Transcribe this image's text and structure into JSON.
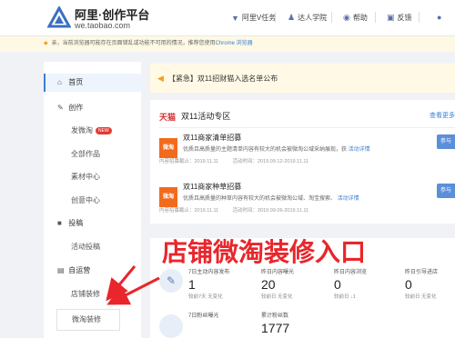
{
  "header": {
    "title": "阿里·创作平台",
    "subtitle": "we.taobao.com",
    "nav": [
      {
        "label": "阿里V任务",
        "icon": "v-task-icon"
      },
      {
        "label": "达人学院",
        "icon": "academy-icon"
      },
      {
        "label": "帮助",
        "icon": "help-icon"
      },
      {
        "label": "反馈",
        "icon": "feedback-icon"
      }
    ]
  },
  "notice": {
    "text": "亲，当前浏览器可能存在页面错乱或功能不可用的情况，推荐您使用",
    "link": "Chrome 浏览器"
  },
  "sidebar": {
    "items": [
      {
        "label": "首页",
        "type": "group",
        "icon": "home-icon",
        "active": true
      },
      {
        "label": "创作",
        "type": "group",
        "icon": "create-icon"
      },
      {
        "label": "发微淘",
        "type": "sub",
        "badge": "NEW"
      },
      {
        "label": "全部作品",
        "type": "sub"
      },
      {
        "label": "素材中心",
        "type": "sub"
      },
      {
        "label": "创意中心",
        "type": "sub"
      },
      {
        "label": "投稿",
        "type": "group",
        "icon": "submit-icon"
      },
      {
        "label": "活动投稿",
        "type": "sub"
      },
      {
        "label": "自运营",
        "type": "group",
        "icon": "self-operate-icon"
      },
      {
        "label": "店铺装修",
        "type": "sub"
      },
      {
        "label": "微淘装修",
        "type": "sub"
      }
    ]
  },
  "urgent": {
    "text": "【紧急】双11招财猫入选名单公布"
  },
  "activity_card": {
    "logo": "天猫",
    "title": "双11活动专区",
    "more": "查看更多",
    "tasks": [
      {
        "thumb": "微淘",
        "name": "双11商家清单招募",
        "desc": "优质且高质量的主题清单内容有较大的机会被微淘公域采纳展现，获",
        "link": "活动详情",
        "deadline": "内容招募截止：2019.11.11",
        "time": "活动时间：2019.09.12-2019.11.11",
        "button": "参与"
      },
      {
        "thumb": "微淘",
        "name": "双11商家种草招募",
        "desc": "优质且高质量的种草内容有较大的机会被微淘公域、淘宝搜索、",
        "link": "活动详情",
        "deadline": "内容招募截止：2019.11.11",
        "time": "活动时间：2019.09.06-2019.11.11",
        "button": "参与"
      }
    ]
  },
  "stats": {
    "row1": [
      {
        "label": "7日主动内容发布",
        "value": "1",
        "change": "较前7天 无变化"
      },
      {
        "label": "昨日内容曝光",
        "value": "20",
        "change": "较前日 无变化"
      },
      {
        "label": "昨日内容浏览",
        "value": "0",
        "change": "较前日 ↓1"
      },
      {
        "label": "昨日引导进店",
        "value": "0",
        "change": "较前日 无变化"
      }
    ],
    "row2": [
      {
        "label": "7日粉丝曝光",
        "value": ""
      },
      {
        "label": "累计粉丝数",
        "value": "1777"
      }
    ]
  },
  "annotation": {
    "text": "店铺微淘装修入口",
    "color": "#e8262b"
  }
}
